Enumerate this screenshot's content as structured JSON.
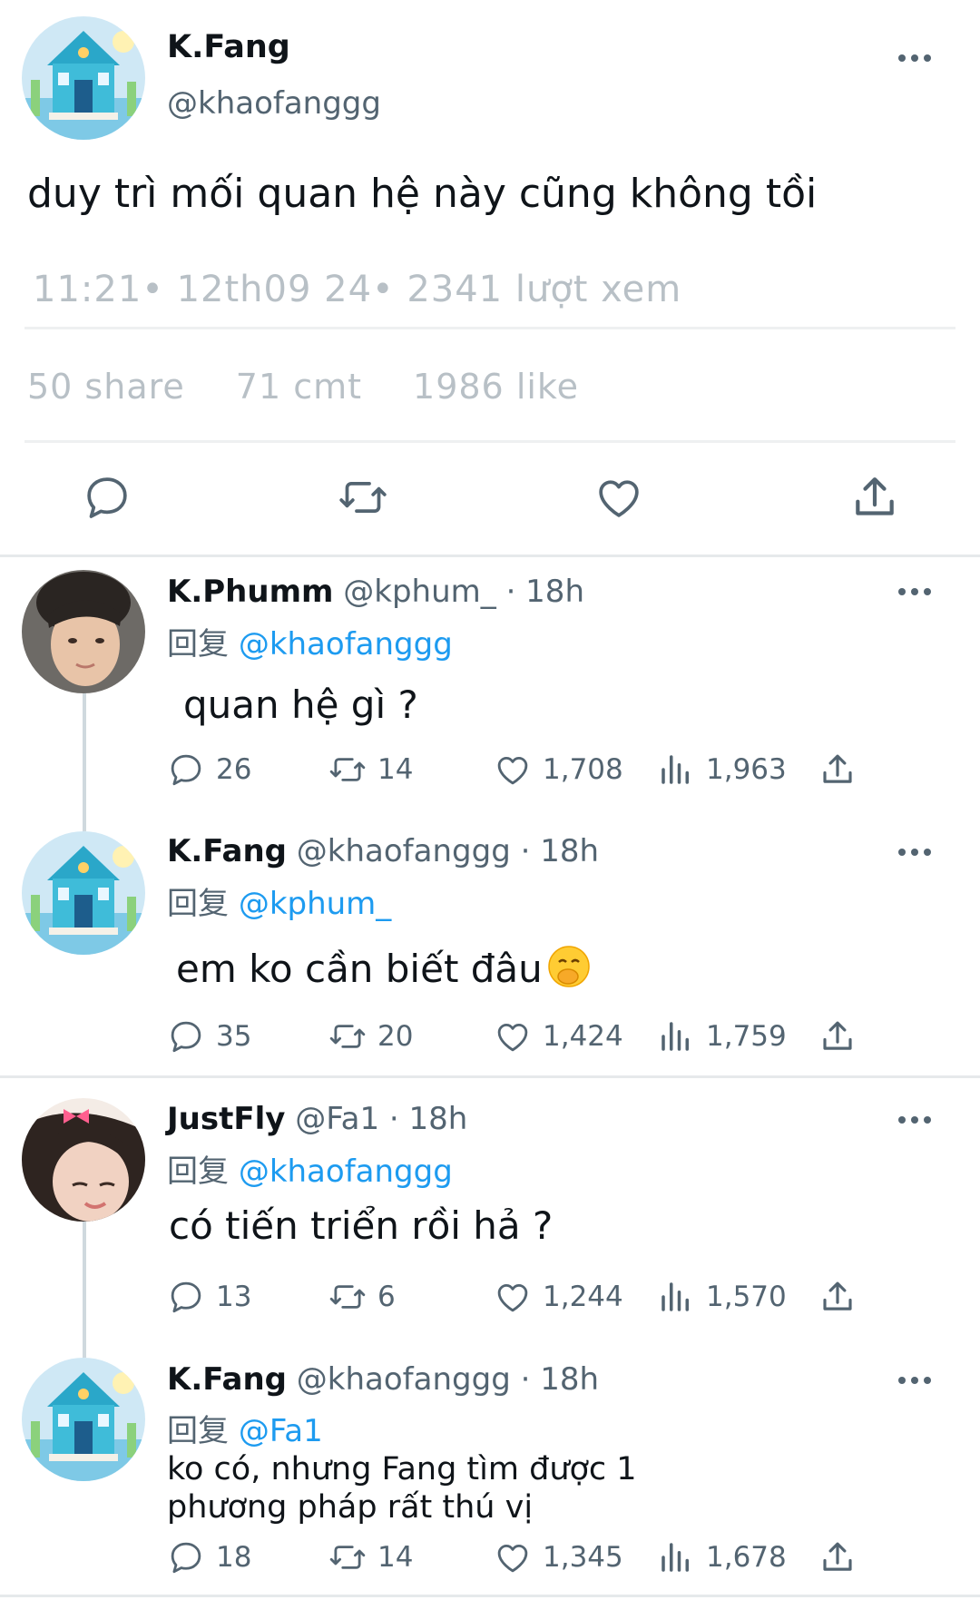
{
  "main_tweet": {
    "author_name": "K.Fang",
    "author_handle": "@khaofanggg",
    "text": "duy trì mối quan hệ này cũng không tồi",
    "meta": "11:21• 12th09 24• 2341 lượt xem",
    "stats": {
      "shares": "50 share",
      "comments": "71 cmt",
      "likes": "1986 like"
    },
    "actions": [
      "comment-icon",
      "retweet-icon",
      "heart-icon",
      "share-icon"
    ]
  },
  "replies": [
    {
      "author_name": "K.Phumm",
      "handle_time": "@kphum_ · 18h",
      "reply_label": "回复",
      "mention": "@khaofanggg",
      "text": "quan hệ gì ?",
      "counts": {
        "comments": "26",
        "retweets": "14",
        "likes": "1,708",
        "views": "1,963"
      }
    },
    {
      "author_name": "K.Fang",
      "handle_time": "@khaofanggg · 18h",
      "reply_label": "回复",
      "mention": "@kphum_",
      "text": "em ko cần biết đâu",
      "emoji": "face-with-hand-over-mouth",
      "counts": {
        "comments": "35",
        "retweets": "20",
        "likes": "1,424",
        "views": "1,759"
      }
    },
    {
      "author_name": "JustFly",
      "handle_time": "@Fa1 · 18h",
      "reply_label": "回复",
      "mention": "@khaofanggg",
      "text": "có tiến triển rồi hả ?",
      "counts": {
        "comments": "13",
        "retweets": "6",
        "likes": "1,244",
        "views": "1,570"
      }
    },
    {
      "author_name": "K.Fang",
      "handle_time": "@khaofanggg · 18h",
      "reply_label": "回复",
      "mention": "@Fa1",
      "text_line1": "ko có, nhưng Fang tìm được 1",
      "text_line2": "phương pháp rất thú vị",
      "counts": {
        "comments": "18",
        "retweets": "14",
        "likes": "1,345",
        "views": "1,678"
      }
    }
  ],
  "colors": {
    "link": "#1d9bf0",
    "secondary": "#536471",
    "meta": "#b8c0c6",
    "thread": "#cfd9de"
  }
}
